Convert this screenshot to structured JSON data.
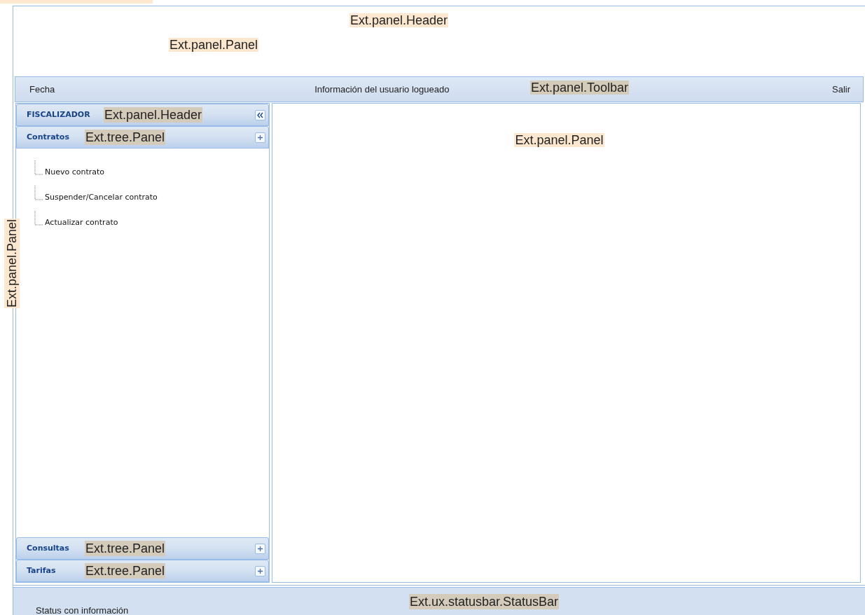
{
  "header": {
    "annotations": [
      {
        "text": "Ext.panel.Header"
      },
      {
        "text": "Ext.panel.Panel"
      }
    ]
  },
  "toolbar": {
    "items": [
      {
        "text": "Fecha"
      },
      {
        "text": "Información del usuario logueado"
      },
      {
        "text": "Salir"
      }
    ],
    "annotation": "Ext.panel.Toolbar"
  },
  "sidebar": {
    "annotation": "Ext.panel.Panel",
    "header": {
      "title": "FISCALIZADOR",
      "annotation": "Ext.panel.Header"
    },
    "sections": [
      {
        "title": "Contratos",
        "annotation": "Ext.tree.Panel",
        "items": [
          {
            "label": "Nuevo contrato"
          },
          {
            "label": "Suspender/Cancelar contrato"
          },
          {
            "label": "Actualizar contrato"
          }
        ]
      },
      {
        "title": "Consultas",
        "annotation": "Ext.tree.Panel"
      },
      {
        "title": "Tarifas",
        "annotation": "Ext.tree.Panel"
      }
    ]
  },
  "main": {
    "annotation": "Ext.panel.Panel"
  },
  "status_bar": {
    "text": "Status con información",
    "annotation": "Ext.ux.statusbar.StatusBar"
  }
}
